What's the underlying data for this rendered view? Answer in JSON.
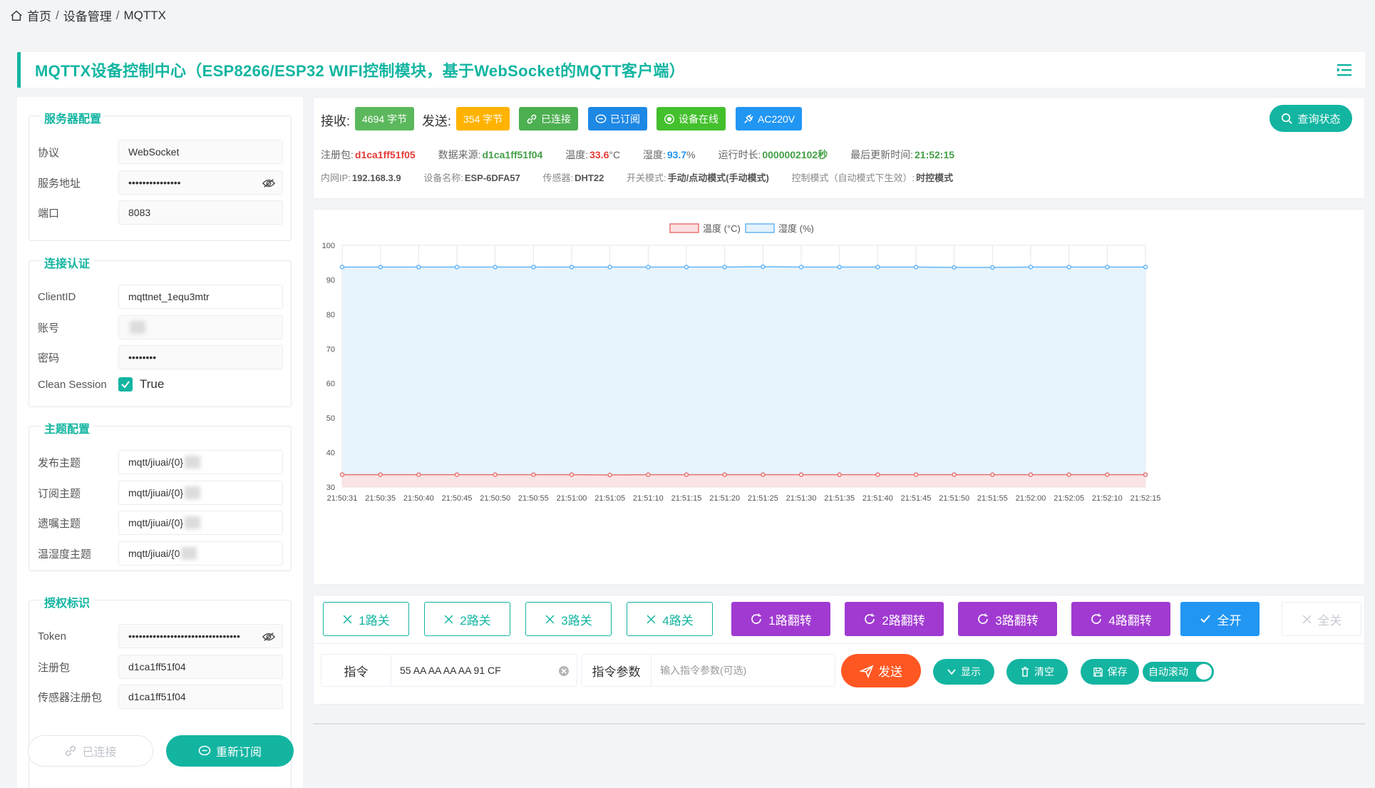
{
  "breadcrumb": {
    "home": "首页",
    "sep": "/",
    "section": "设备管理",
    "page": "MQTTX"
  },
  "title": "MQTTX设备控制中心（ESP8266/ESP32 WIFI控制模块，基于WebSocket的MQTT客户端）",
  "server": {
    "legend": "服务器配置",
    "protocol_label": "协议",
    "protocol_value": "WebSocket",
    "address_label": "服务地址",
    "address_value": "•••••••••••••••",
    "port_label": "端口",
    "port_value": "8083"
  },
  "auth": {
    "legend": "连接认证",
    "clientid_label": "ClientID",
    "clientid_value": "mqttnet_1equ3mtr",
    "account_label": "账号",
    "account_value": "",
    "password_label": "密码",
    "password_value": "••••••••",
    "clean_label": "Clean Session",
    "clean_value": "True"
  },
  "topics": {
    "legend": "主题配置",
    "publish_label": "发布主题",
    "publish_value": "mqtt/jiuai/{0}",
    "subscribe_label": "订阅主题",
    "subscribe_value": "mqtt/jiuai/{0}",
    "will_label": "遗嘱主题",
    "will_value": "mqtt/jiuai/{0}",
    "th_label": "温湿度主题",
    "th_value": "mqtt/jiuai/{0"
  },
  "license": {
    "legend": "授权标识",
    "token_label": "Token",
    "token_value": "••••••••••••••••••••••••••••••••",
    "reg_label": "注册包",
    "reg_value": "d1ca1ff51f04",
    "sensor_label": "传感器注册包",
    "sensor_value": "d1ca1ff51f04"
  },
  "left_buttons": {
    "connected": "已连接",
    "resubscribe": "重新订阅"
  },
  "status": {
    "recv_label": "接收:",
    "recv_value": "4694 字节",
    "send_label": "发送:",
    "send_value": "354 字节",
    "connected": "已连接",
    "subscribed": "已订阅",
    "online": "设备在线",
    "power": "AC220V",
    "query_button": "查询状态",
    "colors": {
      "recv": "#5cb85c",
      "send": "#ffb300",
      "connected": "#4caf50",
      "subscribed": "#1e88e5",
      "online": "#43c02c",
      "power": "#2196f3"
    }
  },
  "info1": {
    "reg_k": "注册包:",
    "reg_v": "d1ca1ff51f05",
    "src_k": "数据来源:",
    "src_v": "d1ca1ff51f04",
    "temp_k": "温度:",
    "temp_v": "33.6",
    "temp_unit": "°C",
    "hum_k": "湿度:",
    "hum_v": "93.7",
    "hum_unit": "%",
    "run_k": "运行时长:",
    "run_v": "0000002102秒",
    "upd_k": "最后更新时间:",
    "upd_v": "21:52:15"
  },
  "info2": {
    "ip_k": "内网IP:",
    "ip_v": "192.168.3.9",
    "name_k": "设备名称:",
    "name_v": "ESP-6DFA57",
    "sensor_k": "传感器:",
    "sensor_v": "DHT22",
    "switch_k": "开关模式:",
    "switch_v": "手动/点动模式(手动模式)",
    "ctrl_k": "控制模式（自动模式下生效）:",
    "ctrl_v": "时控模式"
  },
  "chart_data": {
    "type": "line",
    "x": [
      "21:50:31",
      "21:50:35",
      "21:50:40",
      "21:50:45",
      "21:50:50",
      "21:50:55",
      "21:51:00",
      "21:51:05",
      "21:51:10",
      "21:51:15",
      "21:51:20",
      "21:51:25",
      "21:51:30",
      "21:51:35",
      "21:51:40",
      "21:51:45",
      "21:51:50",
      "21:51:55",
      "21:52:00",
      "21:52:05",
      "21:52:10",
      "21:52:15"
    ],
    "series": [
      {
        "name": "温度 (°C)",
        "color": "#e57373",
        "fill": "#fde0e0",
        "values": [
          33.6,
          33.6,
          33.6,
          33.6,
          33.6,
          33.6,
          33.6,
          33.5,
          33.6,
          33.6,
          33.6,
          33.6,
          33.6,
          33.6,
          33.6,
          33.6,
          33.6,
          33.6,
          33.6,
          33.6,
          33.6,
          33.6
        ]
      },
      {
        "name": "湿度 (%)",
        "color": "#64b5f6",
        "fill": "#e3f2fd",
        "values": [
          93.7,
          93.7,
          93.7,
          93.7,
          93.7,
          93.7,
          93.7,
          93.7,
          93.7,
          93.7,
          93.7,
          93.8,
          93.7,
          93.7,
          93.7,
          93.7,
          93.6,
          93.6,
          93.7,
          93.7,
          93.7,
          93.7
        ]
      }
    ],
    "yticks": [
      100,
      90,
      80,
      70,
      60,
      50,
      40,
      30
    ],
    "ylim": [
      30,
      100
    ],
    "grid": true,
    "legend_position": "top-center"
  },
  "controls": {
    "off": [
      "1路关",
      "2路关",
      "3路关",
      "4路关"
    ],
    "flip": [
      "1路翻转",
      "2路翻转",
      "3路翻转",
      "4路翻转"
    ],
    "all_on": "全开",
    "all_off": "全关",
    "cmd_label": "指令",
    "cmd_value": "55 AA AA AA AA 91 CF",
    "param_label": "指令参数",
    "param_placeholder": "输入指令参数(可选)",
    "send": "发送",
    "show": "显示",
    "clear": "清空",
    "save": "保存",
    "autoscroll": "自动滚动"
  }
}
